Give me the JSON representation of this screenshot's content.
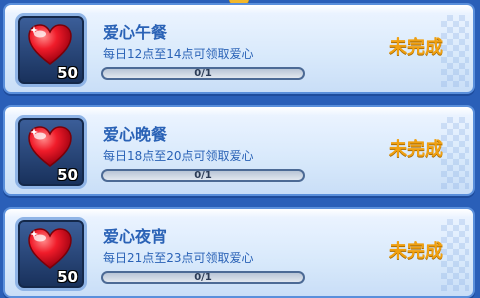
{
  "tasks": [
    {
      "title": "爱心午餐",
      "description": "每日12点至14点可领取爱心",
      "quantity": "50",
      "progress_text": "0/1",
      "progress_fraction": 0,
      "status": "未完成",
      "icon": "heart-icon"
    },
    {
      "title": "爱心晚餐",
      "description": "每日18点至20点可领取爱心",
      "quantity": "50",
      "progress_text": "0/1",
      "progress_fraction": 0,
      "status": "未完成",
      "icon": "heart-icon"
    },
    {
      "title": "爱心夜宵",
      "description": "每日21点至23点可领取爱心",
      "quantity": "50",
      "progress_text": "0/1",
      "progress_fraction": 0,
      "status": "未完成",
      "icon": "heart-icon"
    }
  ],
  "colors": {
    "background": "#2a5fb8",
    "title_blue": "#2a62b6",
    "status_orange": "#f0a010"
  }
}
